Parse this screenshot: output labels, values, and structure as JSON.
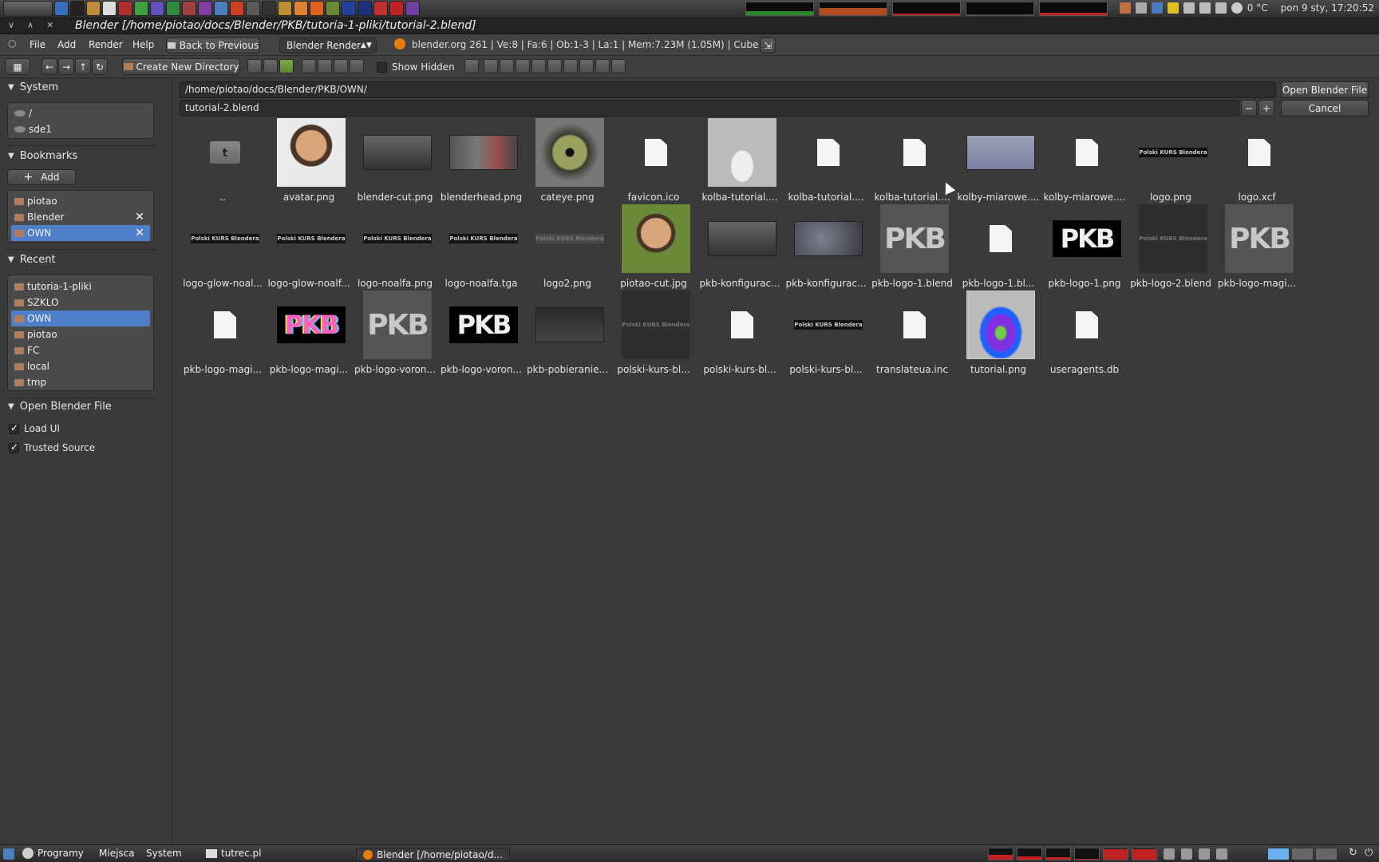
{
  "top_panel": {
    "tray": {
      "temperature": "0 °C",
      "datetime": "pon  9 sty, 17:20:52"
    },
    "monitor_colors": [
      "#2a8a2a",
      "#d05020",
      "#c02020",
      "#1a1a1a",
      "#c02020"
    ]
  },
  "window": {
    "title": "Blender [/home/piotao/docs/Blender/PKB/tutoria-1-pliki/tutorial-2.blend]"
  },
  "menu": {
    "file": "File",
    "add": "Add",
    "render": "Render",
    "help": "Help",
    "back_to_previous": "Back to Previous",
    "render_engine": "Blender Render",
    "stats": "blender.org 261 | Ve:8 | Fa:6 | Ob:1-3 | La:1 | Mem:7.23M (1.05M) | Cube"
  },
  "toolbar": {
    "create_dir": "Create New Directory",
    "show_hidden": "Show Hidden"
  },
  "sidebar": {
    "system": {
      "title": "System",
      "items": [
        "/",
        "sde1"
      ]
    },
    "bookmarks": {
      "title": "Bookmarks",
      "add": "Add",
      "items": [
        "piotao",
        "Blender",
        "OWN"
      ]
    },
    "recent": {
      "title": "Recent",
      "items": [
        "tutoria-1-pliki",
        "SZKLO",
        "OWN",
        "piotao",
        "FC",
        "local",
        "tmp"
      ]
    },
    "open_blender": {
      "title": "Open Blender File",
      "load_ui": "Load UI",
      "trusted_source": "Trusted Source"
    }
  },
  "main": {
    "directory": "/home/piotao/docs/Blender/PKB/OWN/",
    "filename": "tutorial-2.blend",
    "open_button": "Open Blender File",
    "cancel_button": "Cancel",
    "files": [
      {
        "name": "..",
        "thumb": "folder"
      },
      {
        "name": "avatar.png",
        "thumb": "face"
      },
      {
        "name": "blender-cut.png",
        "thumb": "screen"
      },
      {
        "name": "blenderhead.png",
        "thumb": "screen2"
      },
      {
        "name": "cateye.png",
        "thumb": "eye"
      },
      {
        "name": "favicon.ico",
        "thumb": "page"
      },
      {
        "name": "kolba-tutorial....",
        "thumb": "flask-grey"
      },
      {
        "name": "kolba-tutorial....",
        "thumb": "page"
      },
      {
        "name": "kolba-tutorial....",
        "thumb": "page"
      },
      {
        "name": "kolby-miarowe....",
        "thumb": "render"
      },
      {
        "name": "kolby-miarowe....",
        "thumb": "page"
      },
      {
        "name": "logo.png",
        "thumb": "bar"
      },
      {
        "name": "logo.xcf",
        "thumb": "page"
      },
      {
        "name": "logo-glow-noal...",
        "thumb": "bar"
      },
      {
        "name": "logo-glow-noalf...",
        "thumb": "bar"
      },
      {
        "name": "logo-noalfa.png",
        "thumb": "bar"
      },
      {
        "name": "logo-noalfa.tga",
        "thumb": "bar"
      },
      {
        "name": "logo2.png",
        "thumb": "bar-faint"
      },
      {
        "name": "piotao-cut.jpg",
        "thumb": "face-green"
      },
      {
        "name": "pkb-konfigurac...",
        "thumb": "screen"
      },
      {
        "name": "pkb-konfigurac...",
        "thumb": "blur"
      },
      {
        "name": "pkb-logo-1.blend",
        "thumb": "pkb-grey"
      },
      {
        "name": "pkb-logo-1.bl...",
        "thumb": "page"
      },
      {
        "name": "pkb-logo-1.png",
        "thumb": "pkb-black"
      },
      {
        "name": "pkb-logo-2.blend",
        "thumb": "dark"
      },
      {
        "name": "pkb-logo-magi...",
        "thumb": "pkb-grey"
      },
      {
        "name": "pkb-logo-magi...",
        "thumb": "page"
      },
      {
        "name": "pkb-logo-magi...",
        "thumb": "pkb-rainbow"
      },
      {
        "name": "pkb-logo-voron...",
        "thumb": "pkb-grey"
      },
      {
        "name": "pkb-logo-voron...",
        "thumb": "pkb-black"
      },
      {
        "name": "pkb-pobieranie...",
        "thumb": "screen-dark"
      },
      {
        "name": "polski-kurs-bl...",
        "thumb": "dark"
      },
      {
        "name": "polski-kurs-bl...",
        "thumb": "page"
      },
      {
        "name": "polski-kurs-bl...",
        "thumb": "bar"
      },
      {
        "name": "translateua.inc",
        "thumb": "page"
      },
      {
        "name": "tutorial.png",
        "thumb": "flask-color"
      },
      {
        "name": "useragents.db",
        "thumb": "page"
      }
    ],
    "bar_label": "Polski KURS Blendera",
    "pkb_label": "PKB",
    "folder_letter": "t"
  },
  "taskbar": {
    "programs": "Programy",
    "places": "Miejsca",
    "system": "System",
    "task1": "tutrec.pl",
    "task2": "Blender [/home/piotao/d..."
  }
}
